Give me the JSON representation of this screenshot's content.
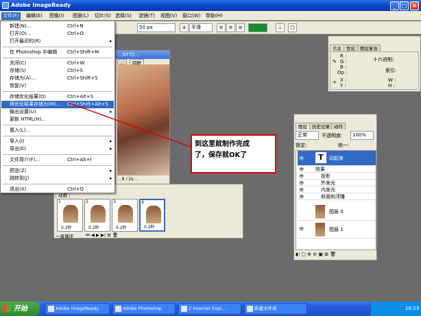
{
  "window": {
    "title": "Adobe ImageReady"
  },
  "menubar": [
    {
      "label": "文件(F)"
    },
    {
      "label": "编辑(E)"
    },
    {
      "label": "图像(I)"
    },
    {
      "label": "图层(L)"
    },
    {
      "label": "切片(S)"
    },
    {
      "label": "选择(S)"
    },
    {
      "label": "滤镜(T)"
    },
    {
      "label": "视图(V)"
    },
    {
      "label": "窗口(W)"
    },
    {
      "label": "帮助(H)"
    }
  ],
  "toolbar": {
    "size": "50 px",
    "aa": "平滑",
    "aa_prefix": "a"
  },
  "file_menu": [
    {
      "label": "新建(N)...",
      "shortcut": "Ctrl+N"
    },
    {
      "label": "打开(O)...",
      "shortcut": "Ctrl+O"
    },
    {
      "label": "打开最近的(R)",
      "shortcut": "",
      "arrow": "▸"
    },
    {
      "label": "在 Photoshop 中编辑",
      "shortcut": "Ctrl+Shift+M"
    },
    {
      "label": "关闭(C)",
      "shortcut": "Ctrl+W"
    },
    {
      "label": "存储(S)",
      "shortcut": "Ctrl+S"
    },
    {
      "label": "存储为(A)...",
      "shortcut": "Ctrl+Shift+S"
    },
    {
      "label": "恢复(V)",
      "shortcut": ""
    },
    {
      "label": "存储优化结果(O)",
      "shortcut": "Ctrl+Alt+S"
    },
    {
      "label": "将优化结果存储为(M)...",
      "shortcut": "Ctrl+Shift+Alt+S"
    },
    {
      "label": "输出设置(U)",
      "shortcut": "",
      "arrow": "▸"
    },
    {
      "label": "更新 HTML(H)...",
      "shortcut": ""
    },
    {
      "label": "置入(L)...",
      "shortcut": ""
    },
    {
      "label": "导入(I)",
      "shortcut": "",
      "arrow": "▸"
    },
    {
      "label": "导出(E)",
      "shortcut": "",
      "arrow": "▸"
    },
    {
      "label": "文件简介(F)...",
      "shortcut": "Ctrl+Alt+I"
    },
    {
      "label": "预览(Z)",
      "shortcut": "",
      "arrow": "▸"
    },
    {
      "label": "跳转到(J)",
      "shortcut": "",
      "arrow": "▸"
    },
    {
      "label": "退出(X)",
      "shortcut": "Ctrl+Q"
    }
  ],
  "document": {
    "title": "...9772...",
    "tab1": "...",
    "tab2": "四联",
    "status": "...8 / 2s..."
  },
  "info_panel": {
    "tabs": [
      "信息",
      "优化",
      "图层复合"
    ],
    "r": "R :",
    "g": "G :",
    "b": "B :",
    "op": "Op :",
    "hex_label": "十六进制:",
    "index_label": "索引:",
    "x": "X :",
    "y": "Y :",
    "w": "W :",
    "h": "H :"
  },
  "layers_panel": {
    "tabs": [
      "图层",
      "历史记录",
      "动作"
    ],
    "blend": "正常",
    "opacity_label": "不透明度:",
    "opacity": "100%",
    "lock_label": "锁定:",
    "unify_label": "统一:",
    "text_layer": "动起来",
    "effects_label": "效果",
    "effects": [
      "投影",
      "外发光",
      "内发光",
      "斜面和浮雕"
    ],
    "layer0": "图层 0",
    "layer1": "图层 1"
  },
  "animation_panel": {
    "tab": "动画",
    "frames": [
      {
        "num": "1",
        "delay": "0.2秒"
      },
      {
        "num": "2",
        "delay": "0.2秒"
      },
      {
        "num": "3",
        "delay": "0.2秒"
      },
      {
        "num": "4",
        "delay": "0.2秒"
      }
    ],
    "loop": "一直循环"
  },
  "callout": {
    "line1": "到这里就制作完成",
    "line2": "了，保存就OK了"
  },
  "taskbar": {
    "start": "开始",
    "buttons": [
      "Adobe ImageReady",
      "Adobe Photoshop",
      "2 Internet Expl...",
      "新建文件夹"
    ],
    "time": "16:23"
  },
  "colors": {
    "title": "#0a46c8",
    "highlight": "#316ac5",
    "callout_border": "#e00000",
    "taskbar": "#245edb"
  }
}
